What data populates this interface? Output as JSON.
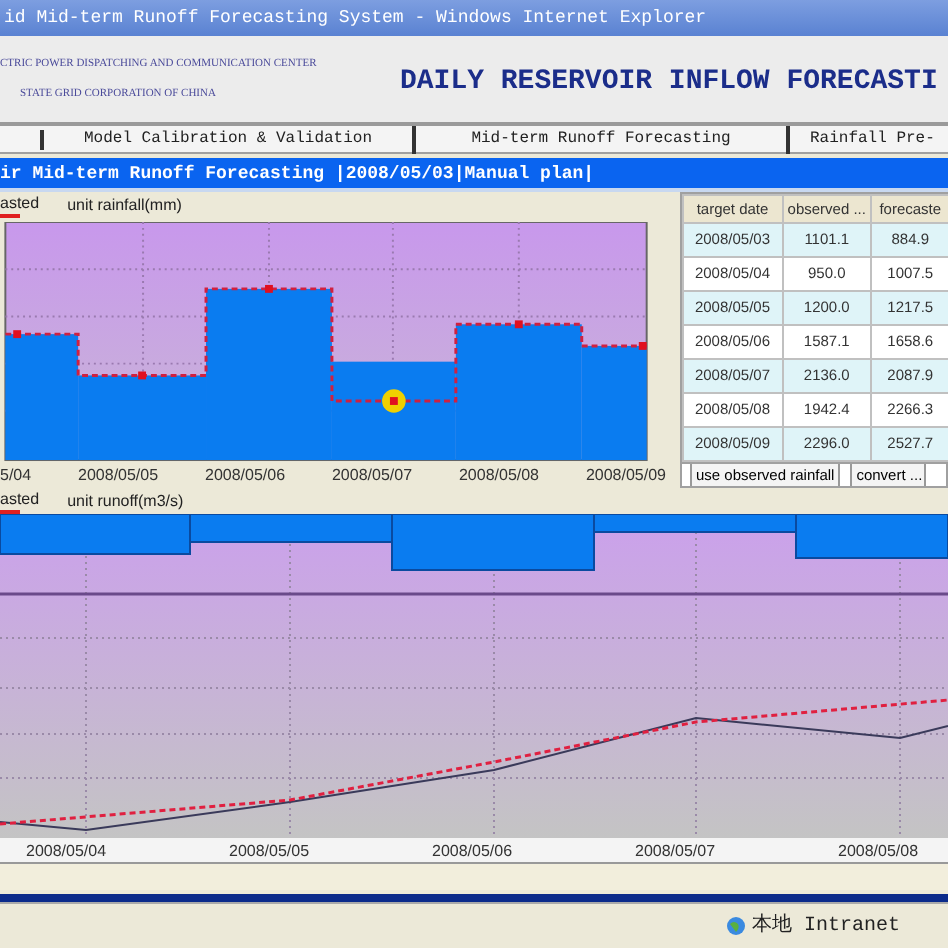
{
  "window": {
    "title": "id Mid-term Runoff Forecasting System - Windows Internet Explorer"
  },
  "header": {
    "org_lines": [
      "CTRIC POWER DISPATCHING AND COMMUNICATION CENTER",
      "STATE GRID CORPORATION OF CHINA"
    ],
    "app_title": "DAILY RESERVOIR INFLOW FORECASTI"
  },
  "nav": [
    {
      "label": "Model Calibration & Validation",
      "selected": false
    },
    {
      "label": "Mid-term Runoff Forecasting",
      "selected": false
    },
    {
      "label": "Rainfall Pre-",
      "selected": false
    }
  ],
  "panel_title": "ir Mid-term Runoff Forecasting |2008/05/03|Manual plan|",
  "rainfall_chart": {
    "legend": "asted",
    "unit": "unit rainfall(mm)",
    "x_labels": [
      "5/04",
      "2008/05/05",
      "2008/05/06",
      "2008/05/07",
      "2008/05/08",
      "2008/05/09"
    ]
  },
  "table": {
    "columns": [
      "target date",
      "observed ...",
      "forecaste"
    ],
    "rows": [
      [
        "2008/05/03",
        "1101.1",
        "884.9"
      ],
      [
        "2008/05/04",
        "950.0",
        "1007.5"
      ],
      [
        "2008/05/05",
        "1200.0",
        "1217.5"
      ],
      [
        "2008/05/06",
        "1587.1",
        "1658.6"
      ],
      [
        "2008/05/07",
        "2136.0",
        "2087.9"
      ],
      [
        "2008/05/08",
        "1942.4",
        "2266.3"
      ],
      [
        "2008/05/09",
        "2296.0",
        "2527.7"
      ]
    ],
    "buttons": [
      "use observed rainfall",
      "convert ..."
    ]
  },
  "runoff_chart": {
    "legend": "asted",
    "unit": "unit runoff(m3/s)",
    "x_labels": [
      "2008/05/04",
      "2008/05/05",
      "2008/05/06",
      "2008/05/07",
      "2008/05/08"
    ]
  },
  "status_bar": {
    "zone": "本地 Intranet"
  }
}
